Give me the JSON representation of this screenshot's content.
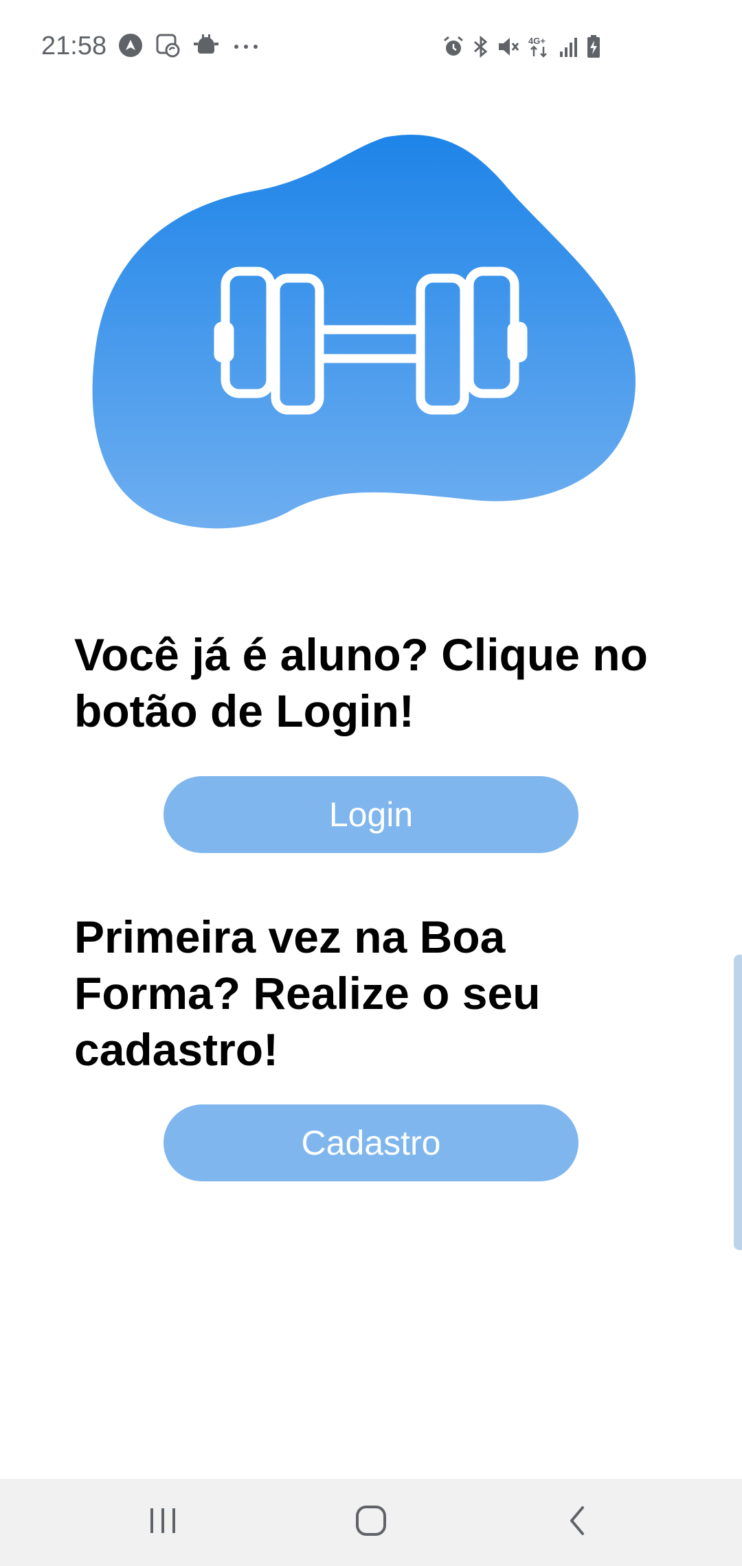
{
  "status_bar": {
    "time": "21:58",
    "left_icons": [
      "navigation-app-icon",
      "photo-sync-icon",
      "android-debug-icon",
      "more-dots-icon"
    ],
    "right_icons": [
      "alarm-icon",
      "bluetooth-icon",
      "muted-icon",
      "4g-data-icon",
      "signal-icon",
      "battery-charging-icon"
    ],
    "network_label": "4G+"
  },
  "hero": {
    "icon": "dumbbell-icon",
    "blob_colors": [
      "#1e84e8",
      "#6eaef0"
    ]
  },
  "login_section": {
    "heading": "Você já é aluno? Clique no botão de Login!",
    "button_label": "Login"
  },
  "signup_section": {
    "heading": "Primeira vez na Boa Forma? Realize o seu cadastro!",
    "button_label": "Cadastro"
  },
  "colors": {
    "button_bg": "#7fb6ee",
    "button_text": "#ffffff",
    "heading_text": "#000000",
    "nav_bg": "#f1f1f1"
  },
  "nav_bar": {
    "buttons": [
      "recents-icon",
      "home-icon",
      "back-icon"
    ]
  }
}
